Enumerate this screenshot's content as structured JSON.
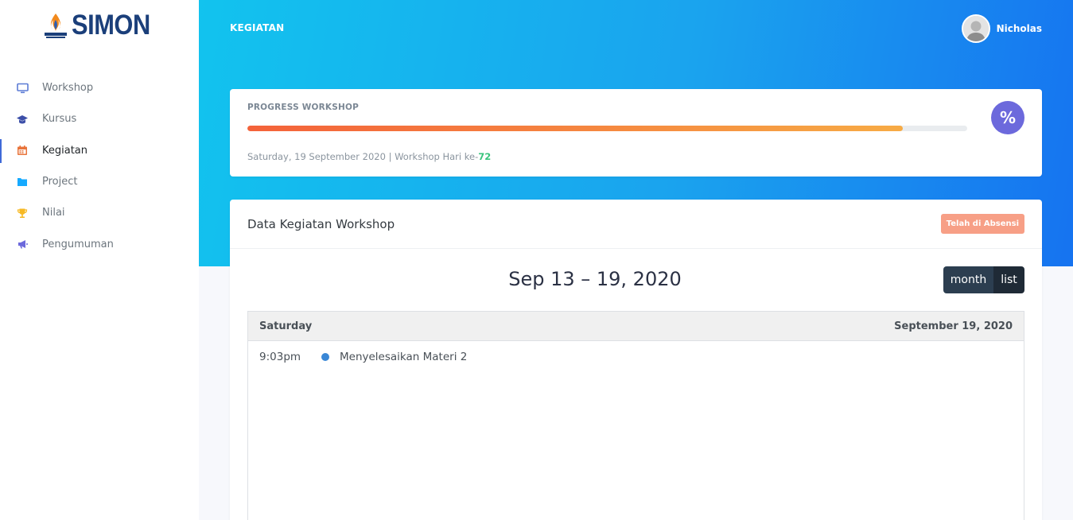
{
  "brand": {
    "name": "SIMON"
  },
  "sidebar": {
    "items": [
      {
        "label": "Workshop",
        "icon": "monitor-icon",
        "active": false
      },
      {
        "label": "Kursus",
        "icon": "graduation-cap-icon",
        "active": false
      },
      {
        "label": "Kegiatan",
        "icon": "calendar-icon",
        "active": true
      },
      {
        "label": "Project",
        "icon": "folder-icon",
        "active": false
      },
      {
        "label": "Nilai",
        "icon": "trophy-icon",
        "active": false
      },
      {
        "label": "Pengumuman",
        "icon": "megaphone-icon",
        "active": false
      }
    ]
  },
  "header": {
    "title": "KEGIATAN",
    "user_name": "Nicholas"
  },
  "progress": {
    "title": "PROGRESS WORKSHOP",
    "percent": 91,
    "date_text": "Saturday, 19 September 2020 | Workshop Hari ke-",
    "day_number": "72",
    "icon_symbol": "%"
  },
  "calendar": {
    "card_title": "Data Kegiatan Workshop",
    "badge": "Telah di Absensi",
    "range_title": "Sep 13 – 19, 2020",
    "views": {
      "month": "month",
      "list": "list"
    },
    "list": {
      "day_name": "Saturday",
      "day_date": "September 19, 2020",
      "events": [
        {
          "time": "9:03pm",
          "title": "Menyelesaikan Materi 2"
        }
      ]
    }
  },
  "colors": {
    "accent": "#3f6ad8",
    "progress_start": "#f4623a",
    "progress_end": "#f7ab45",
    "badge": "#f79f86",
    "day_number": "#3ac47d",
    "event_dot": "#3a87d6"
  }
}
